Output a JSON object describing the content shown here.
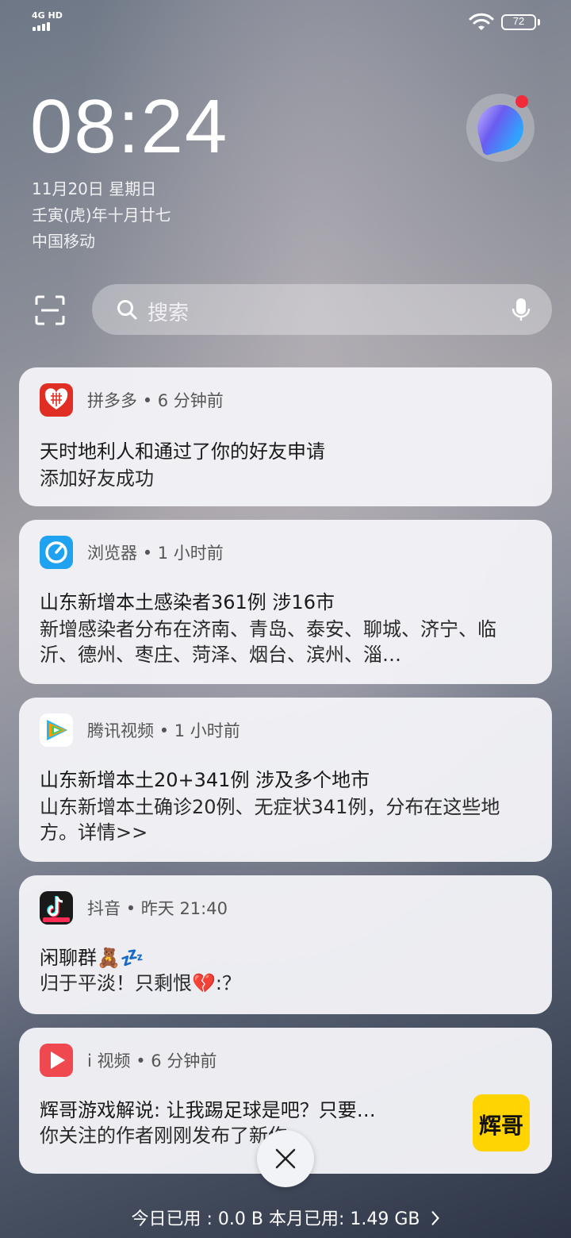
{
  "status": {
    "network": "4G HD",
    "battery": "72"
  },
  "lockscreen": {
    "time": "08:24",
    "date": "11月20日 星期日",
    "lunar": "壬寅(虎)年十月廿七",
    "carrier": "中国移动"
  },
  "search": {
    "placeholder": "搜索"
  },
  "notifications": [
    {
      "app": "拼多多",
      "time": "6 分钟前",
      "title": "天时地利人和通过了你的好友申请",
      "body": "添加好友成功"
    },
    {
      "app": "浏览器",
      "time": "1 小时前",
      "title": "山东新增本土感染者361例 涉16市",
      "body": "新增感染者分布在济南、青岛、泰安、聊城、济宁、临沂、德州、枣庄、菏泽、烟台、滨州、淄…"
    },
    {
      "app": "腾讯视频",
      "time": "1 小时前",
      "title": "山东新增本土20+341例 涉及多个地市",
      "body": "山东新增本土确诊20例、无症状341例，分布在这些地方。详情>>"
    },
    {
      "app": "抖音",
      "time": "昨天 21:40",
      "title": "闲聊群🧸💤",
      "body": "归于平淡！只剩恨💔:？"
    },
    {
      "app": "i 视频",
      "time": "6 分钟前",
      "title": "辉哥游戏解说: 让我踢足球是吧？只要…",
      "body": "你关注的作者刚刚发布了新作",
      "thumb_text": "辉哥"
    }
  ],
  "footer": {
    "data_usage": "今日已用 : 0.0 B 本月已用: 1.49 GB"
  },
  "icons": {
    "close": "close-icon",
    "chevron": "chevron-right-icon"
  },
  "colors": {
    "pdd": "#e02e24",
    "browser": "#1fa3f0",
    "douyin": "#1a1a1a",
    "ivideo": "#f0484f",
    "thumb": "#ffd400"
  },
  "separator": "•"
}
